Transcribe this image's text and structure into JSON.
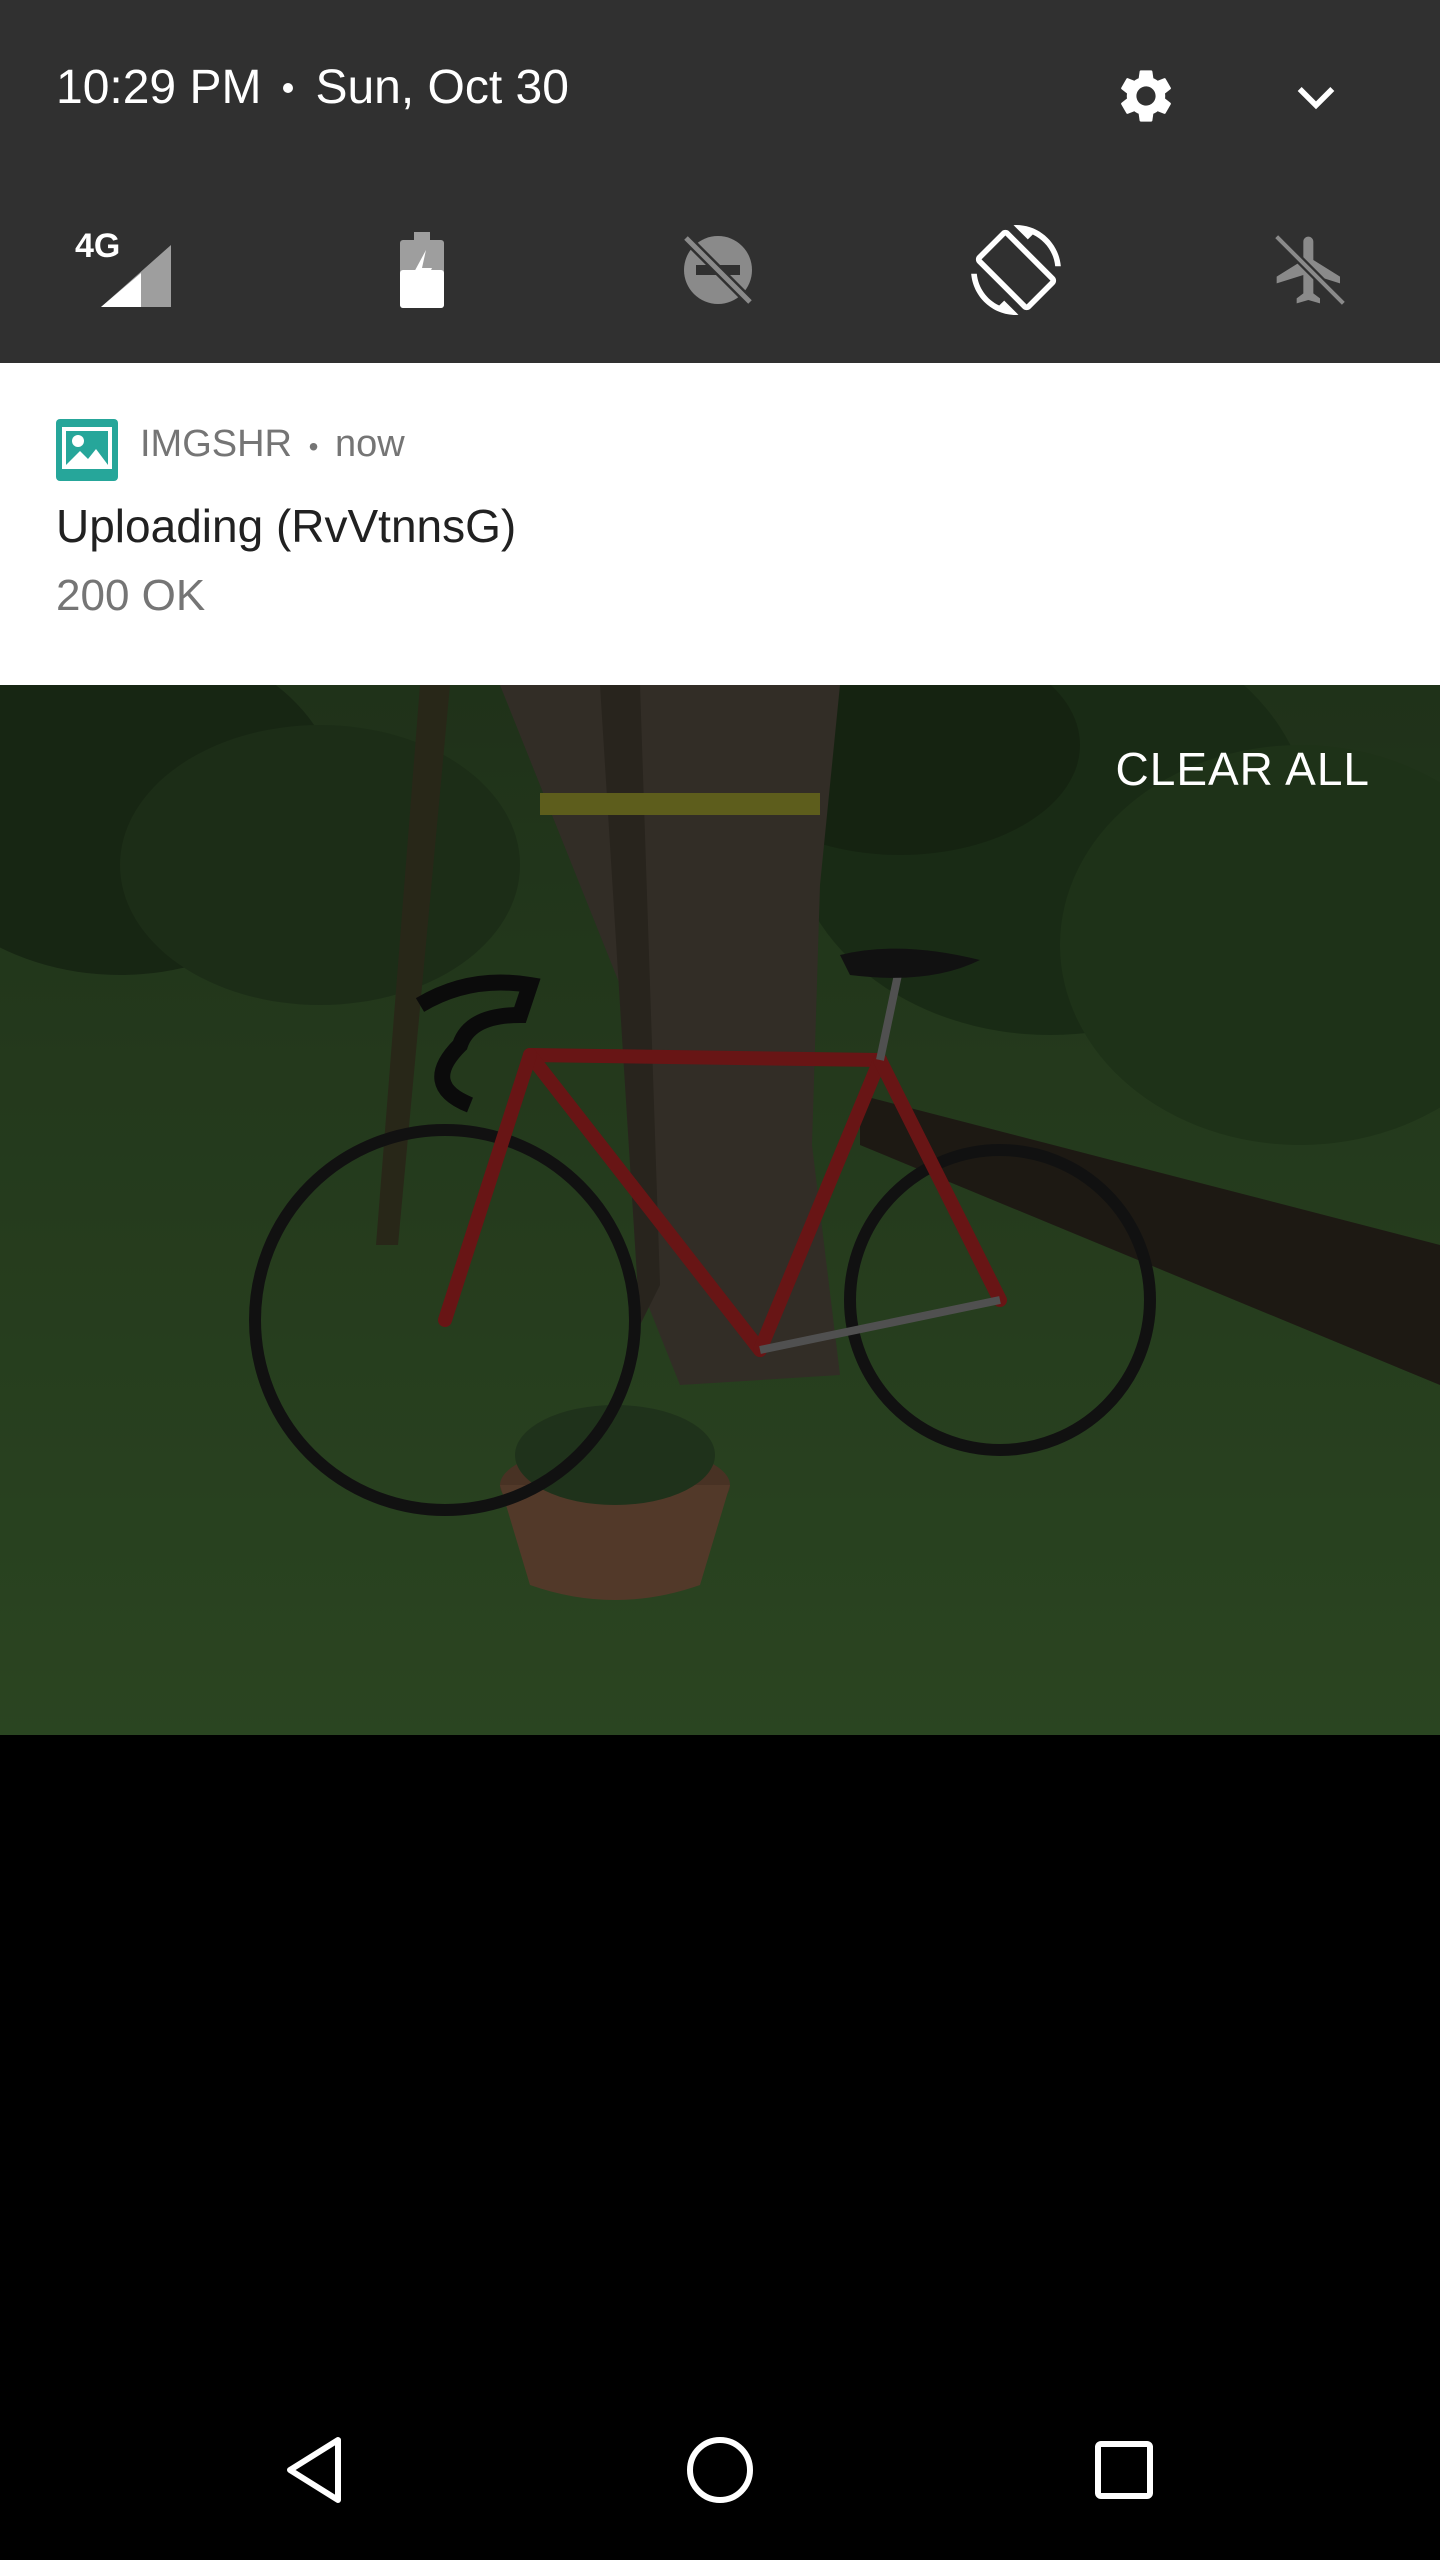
{
  "status": {
    "time": "10:29 PM",
    "date": "Sun, Oct 30"
  },
  "header": {
    "settings_icon": "gear-icon",
    "expand_icon": "chevron-down-icon"
  },
  "quick_settings": [
    {
      "name": "cellular",
      "label": "4G",
      "icon": "signal-icon"
    },
    {
      "name": "battery",
      "icon": "battery-charging-icon"
    },
    {
      "name": "do-not-disturb",
      "icon": "dnd-off-icon"
    },
    {
      "name": "auto-rotate",
      "icon": "rotate-icon"
    },
    {
      "name": "airplane-mode",
      "icon": "airplane-icon"
    }
  ],
  "notification": {
    "app_name": "IMGSHR",
    "separator": "•",
    "when": "now",
    "title": "Uploading (RvVtnnsG)",
    "text": "200 OK"
  },
  "clear_all_label": "CLEAR ALL",
  "navigation": {
    "back_icon": "back-icon",
    "home_icon": "home-icon",
    "recents_icon": "recents-icon"
  },
  "colors": {
    "shade": "#303030",
    "notification_bg": "#ffffff",
    "app_icon": "#26a69a"
  }
}
